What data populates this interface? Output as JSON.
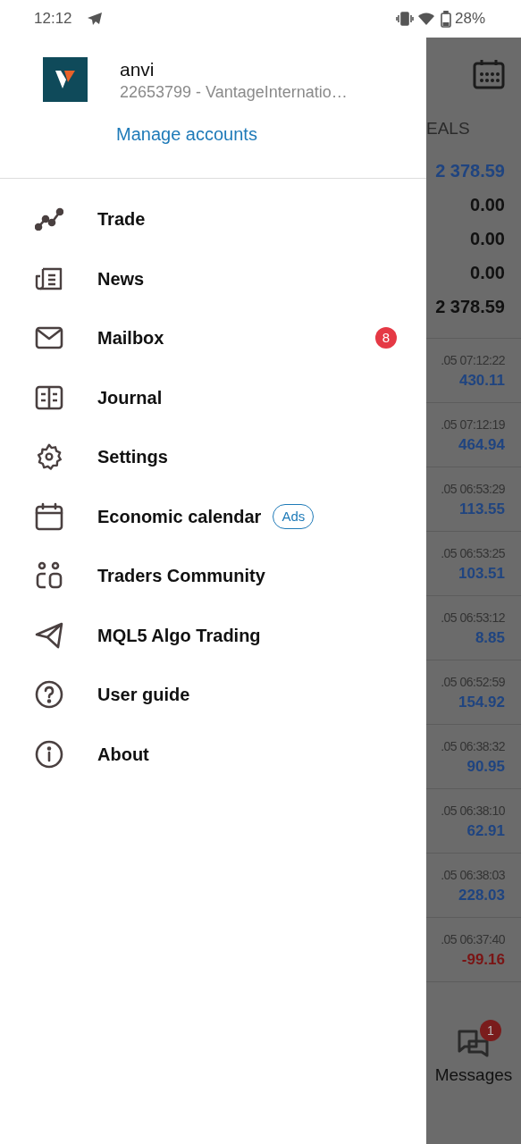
{
  "status_bar": {
    "time": "12:12",
    "battery": "28%"
  },
  "drawer": {
    "account": {
      "name": "anvi",
      "id": "22653799 - VantageInternatio…",
      "manage_link": "Manage accounts"
    },
    "menu": [
      {
        "label": "Trade"
      },
      {
        "label": "News"
      },
      {
        "label": "Mailbox",
        "badge": "8"
      },
      {
        "label": "Journal"
      },
      {
        "label": "Settings"
      },
      {
        "label": "Economic calendar",
        "tag": "Ads"
      },
      {
        "label": "Traders Community"
      },
      {
        "label": "MQL5 Algo Trading"
      },
      {
        "label": "User guide"
      },
      {
        "label": "About"
      }
    ]
  },
  "background": {
    "tab_label": "EALS",
    "summary": [
      {
        "value": "2 378.59",
        "color": "#1f4480"
      },
      {
        "value": "0.00",
        "color": "#111111"
      },
      {
        "value": "0.00",
        "color": "#111111"
      },
      {
        "value": "0.00",
        "color": "#111111"
      },
      {
        "value": "2 378.59",
        "color": "#111111"
      }
    ],
    "deals": [
      {
        "time": ".05 07:12:22",
        "profit": "430.11",
        "color": "#1f4480"
      },
      {
        "time": ".05 07:12:19",
        "profit": "464.94",
        "color": "#1f4480"
      },
      {
        "time": ".05 06:53:29",
        "profit": "113.55",
        "color": "#1f4480"
      },
      {
        "time": ".05 06:53:25",
        "profit": "103.51",
        "color": "#1f4480"
      },
      {
        "time": ".05 06:53:12",
        "profit": "8.85",
        "color": "#1f4480"
      },
      {
        "time": ".05 06:52:59",
        "profit": "154.92",
        "color": "#1f4480"
      },
      {
        "time": ".05 06:38:32",
        "profit": "90.95",
        "color": "#1f4480"
      },
      {
        "time": ".05 06:38:10",
        "profit": "62.91",
        "color": "#1f4480"
      },
      {
        "time": ".05 06:38:03",
        "profit": "228.03",
        "color": "#1f4480"
      },
      {
        "time": ".05 06:37:40",
        "profit": "-99.16",
        "color": "#7a1414"
      }
    ],
    "messages": {
      "label": "Messages",
      "badge": "1"
    }
  }
}
